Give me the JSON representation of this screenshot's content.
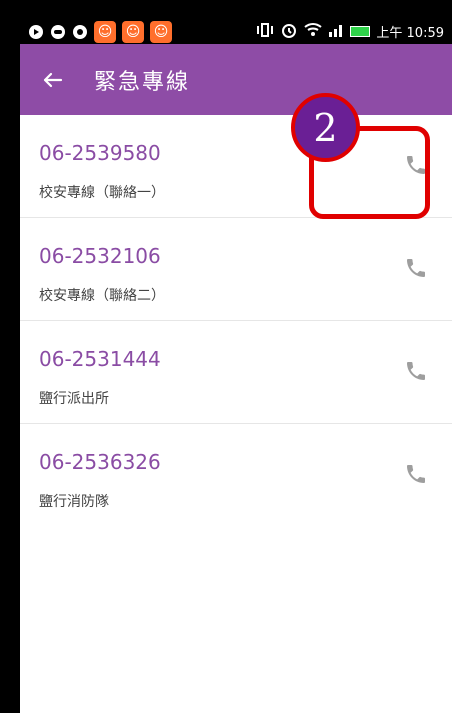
{
  "status_bar": {
    "time": "上午 10:59"
  },
  "app_bar": {
    "title": "緊急專線",
    "back_icon": "arrow-left-icon"
  },
  "contacts": [
    {
      "number": "06-2539580",
      "label": "校安專線（聯絡一）",
      "icon": "phone-icon"
    },
    {
      "number": "06-2532106",
      "label": "校安專線（聯絡二）",
      "icon": "phone-icon"
    },
    {
      "number": "06-2531444",
      "label": "鹽行派出所",
      "icon": "phone-icon"
    },
    {
      "number": "06-2536326",
      "label": "鹽行消防隊",
      "icon": "phone-icon"
    }
  ],
  "annotation": {
    "badge": "2",
    "color": "#e00000",
    "badge_color": "#6a1f95"
  },
  "colors": {
    "app_bar": "#8e4ca6",
    "number_text": "#8a4ca4",
    "call_icon": "#9e9e9e"
  }
}
